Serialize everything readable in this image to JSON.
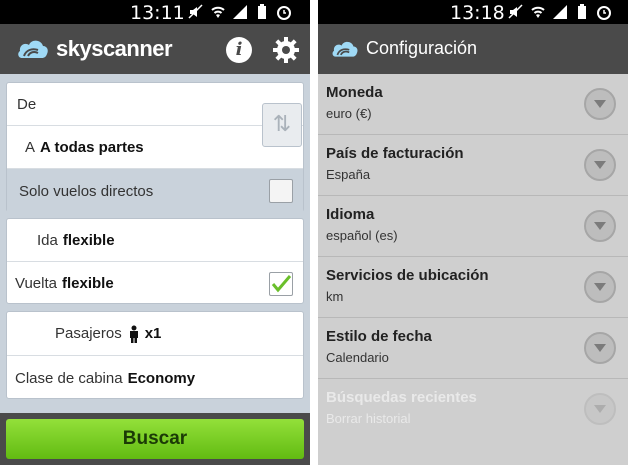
{
  "left": {
    "status": {
      "time": "13:11"
    },
    "app_bar": {
      "brand": "skyscanner"
    },
    "route": {
      "from_label": "De",
      "to_label": "A",
      "to_value": "A todas partes",
      "direct_label": "Solo vuelos directos"
    },
    "dates": {
      "outbound_label": "Ida",
      "outbound_value": "flexible",
      "return_label": "Vuelta",
      "return_value": "flexible"
    },
    "passengers": {
      "label": "Pasajeros",
      "value": "x1",
      "cabin_label": "Clase de cabina",
      "cabin_value": "Economy"
    },
    "search_button": "Buscar",
    "colors": {
      "accent": "#7ed321",
      "appbar": "#4a4a4a",
      "checkmark": "#6abf2a"
    }
  },
  "right": {
    "status": {
      "time": "13:18"
    },
    "app_bar": {
      "title": "Configuración"
    },
    "settings": [
      {
        "title": "Moneda",
        "value": "euro (€)"
      },
      {
        "title": "País de facturación",
        "value": "España"
      },
      {
        "title": "Idioma",
        "value": "español (es)"
      },
      {
        "title": "Servicios de ubicación",
        "value": "km"
      },
      {
        "title": "Estilo de fecha",
        "value": "Calendario"
      },
      {
        "title": "Búsquedas recientes",
        "value": "Borrar historial",
        "disabled": true
      }
    ]
  }
}
